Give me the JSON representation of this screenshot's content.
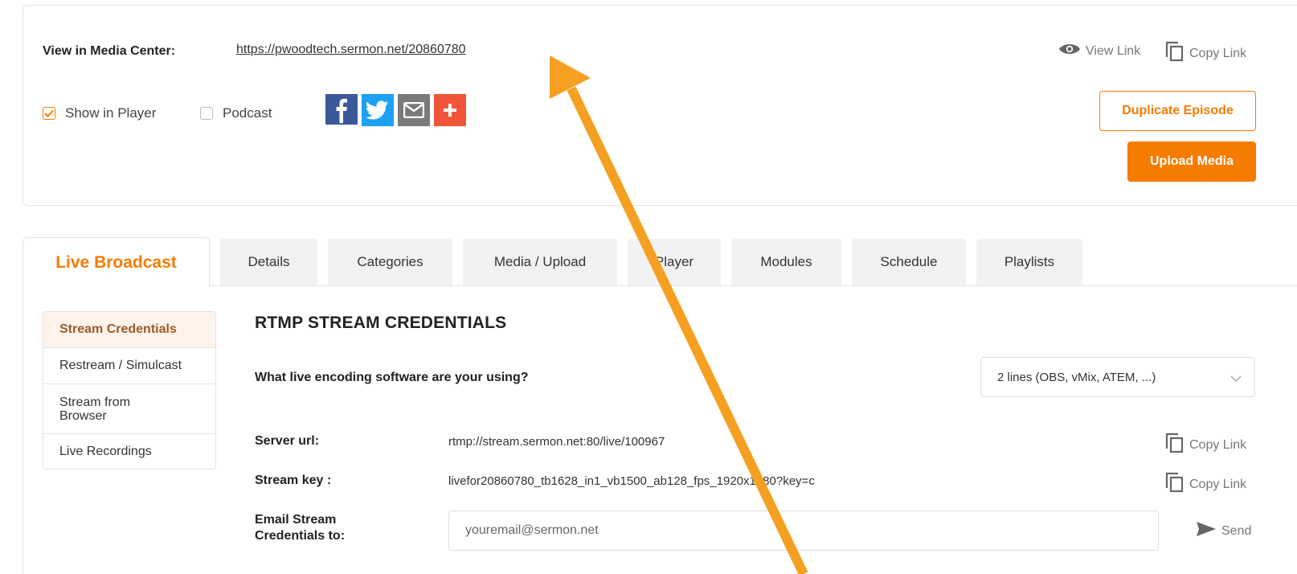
{
  "episode": {
    "media_center_label": "View in Media Center:",
    "media_center_url": "https://pwoodtech.sermon.net/20860780",
    "view_link_label": "View Link",
    "copy_link_label": "Copy Link",
    "show_in_player_label": "Show in Player",
    "show_in_player_checked": true,
    "podcast_label": "Podcast",
    "podcast_checked": false,
    "duplicate_label": "Duplicate Episode",
    "upload_label": "Upload Media",
    "share_icons": [
      "facebook-icon",
      "twitter-icon",
      "email-icon",
      "plus-icon"
    ]
  },
  "tabs": [
    {
      "label": "Live Broadcast",
      "active": true
    },
    {
      "label": "Details"
    },
    {
      "label": "Categories"
    },
    {
      "label": "Media / Upload"
    },
    {
      "label": "Player"
    },
    {
      "label": "Modules"
    },
    {
      "label": "Schedule"
    },
    {
      "label": "Playlists"
    }
  ],
  "side_menu": [
    {
      "label": "Stream Credentials",
      "active": true
    },
    {
      "label": "Restream / Simulcast"
    },
    {
      "label": "Stream from Browser"
    },
    {
      "label": "Live Recordings"
    }
  ],
  "credentials": {
    "title": "RTMP STREAM CREDENTIALS",
    "question": "What live encoding software are your using?",
    "selected_software": "2 lines (OBS, vMix, ATEM, ...)",
    "server_url_label": "Server url:",
    "server_url_value": "rtmp://stream.sermon.net:80/live/100967",
    "stream_key_label": "Stream key :",
    "stream_key_value": "livefor20860780_tb1628_in1_vb1500_ab128_fps_1920x1080?key=c",
    "copy_link_label": "Copy Link",
    "email_label": "Email Stream Credentials to:",
    "email_placeholder": "youremail@sermon.net",
    "send_label": "Send"
  },
  "colors": {
    "accent": "#f57c00",
    "arrow": "#f5a020",
    "facebook": "#3b5998",
    "twitter": "#1da1f2",
    "email": "#7a7a7a",
    "plus": "#f0553a"
  }
}
